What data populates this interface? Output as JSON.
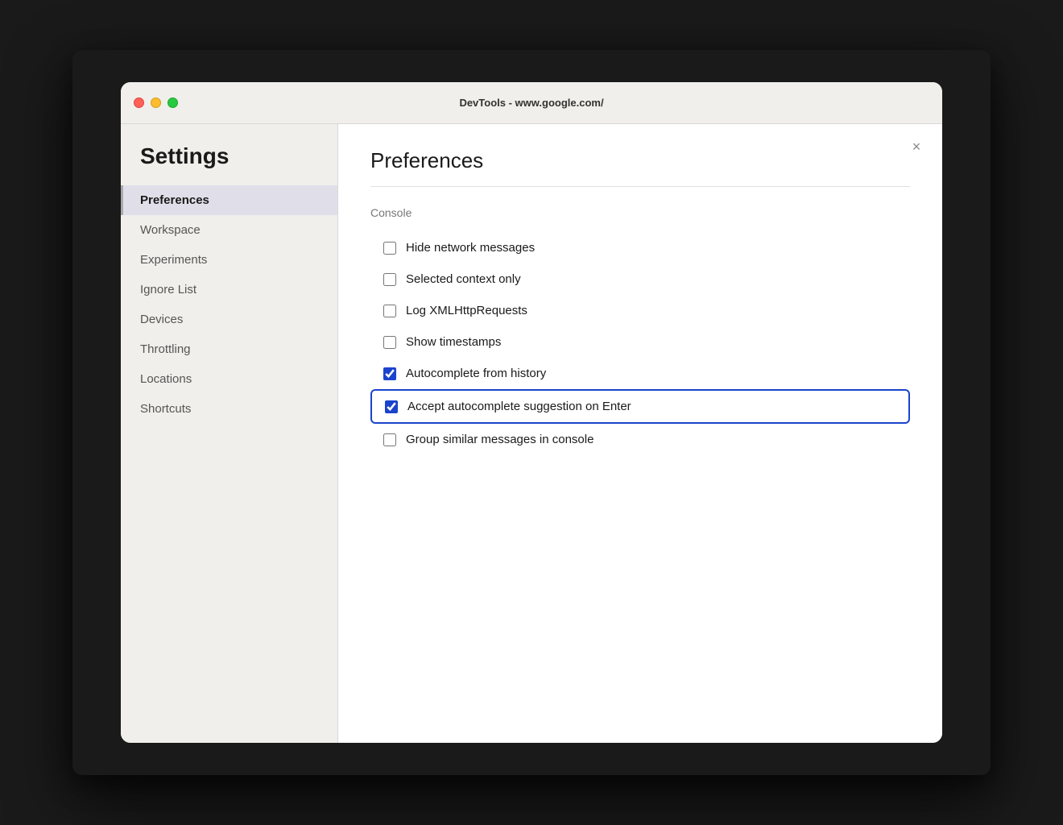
{
  "window": {
    "title": "DevTools - www.google.com/"
  },
  "sidebar": {
    "title": "Settings",
    "nav_items": [
      {
        "id": "preferences",
        "label": "Preferences",
        "active": true
      },
      {
        "id": "workspace",
        "label": "Workspace",
        "active": false
      },
      {
        "id": "experiments",
        "label": "Experiments",
        "active": false
      },
      {
        "id": "ignore-list",
        "label": "Ignore List",
        "active": false
      },
      {
        "id": "devices",
        "label": "Devices",
        "active": false
      },
      {
        "id": "throttling",
        "label": "Throttling",
        "active": false
      },
      {
        "id": "locations",
        "label": "Locations",
        "active": false
      },
      {
        "id": "shortcuts",
        "label": "Shortcuts",
        "active": false
      }
    ]
  },
  "main": {
    "section_title": "Preferences",
    "subsection_title": "Console",
    "close_label": "×",
    "checkboxes": [
      {
        "id": "hide-network",
        "label": "Hide network messages",
        "checked": false,
        "highlighted": false
      },
      {
        "id": "selected-context",
        "label": "Selected context only",
        "checked": false,
        "highlighted": false
      },
      {
        "id": "log-xml",
        "label": "Log XMLHttpRequests",
        "checked": false,
        "highlighted": false
      },
      {
        "id": "show-timestamps",
        "label": "Show timestamps",
        "checked": false,
        "highlighted": false
      },
      {
        "id": "autocomplete-history",
        "label": "Autocomplete from history",
        "checked": true,
        "highlighted": false
      },
      {
        "id": "accept-autocomplete",
        "label": "Accept autocomplete suggestion on Enter",
        "checked": true,
        "highlighted": true
      },
      {
        "id": "group-similar",
        "label": "Group similar messages in console",
        "checked": false,
        "highlighted": false
      }
    ]
  },
  "colors": {
    "close_traffic": "#ff5f57",
    "minimize_traffic": "#febc2e",
    "maximize_traffic": "#28c840",
    "highlight_border": "#1a44cc"
  }
}
